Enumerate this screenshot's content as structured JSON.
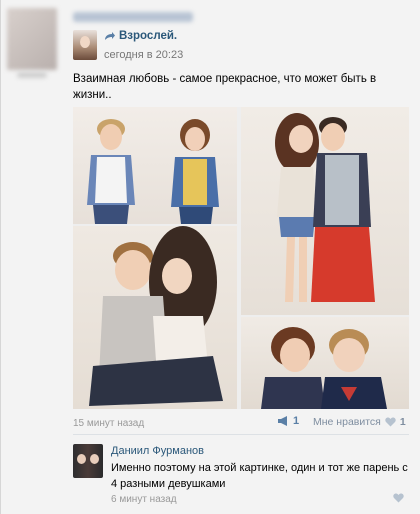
{
  "post": {
    "group_name": "Взрослей.",
    "timestamp": "сегодня в 20:23",
    "text": "Взаимная любовь - самое прекрасное, что может быть в жизни..",
    "photos": [
      "photo-1",
      "photo-2",
      "photo-3",
      "photo-4"
    ]
  },
  "footer": {
    "time_ago": "15 минут назад",
    "share_count": "1",
    "like_label": "Мне нравится",
    "like_count": "1"
  },
  "comment": {
    "author": "Даниил Фурманов",
    "text": "Именно поэтому на этой картинке, один и тот же парень с 4 разными девушками",
    "time_ago": "6 минут назад"
  },
  "colors": {
    "link": "#2b587a",
    "muted": "#999999",
    "background": "#f3f3f3"
  }
}
